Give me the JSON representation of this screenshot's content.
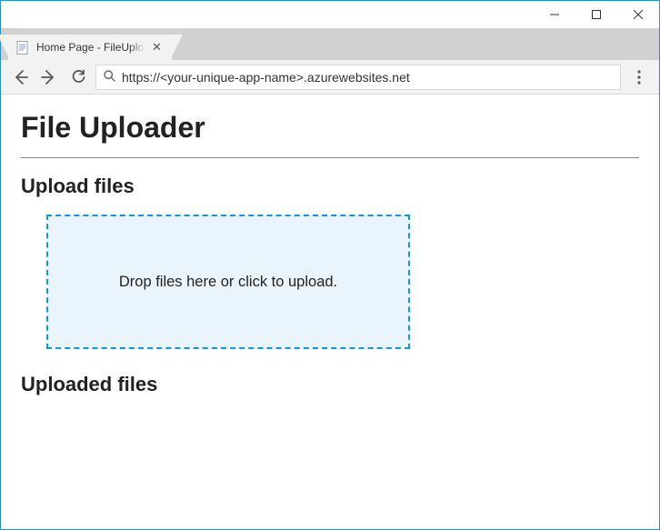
{
  "window": {
    "tab_title": "Home Page - FileUploade"
  },
  "toolbar": {
    "address": "https://<your-unique-app-name>.azurewebsites.net"
  },
  "page": {
    "title": "File Uploader",
    "section_upload": "Upload files",
    "dropzone_text": "Drop files here or click to upload.",
    "section_uploaded": "Uploaded files"
  }
}
